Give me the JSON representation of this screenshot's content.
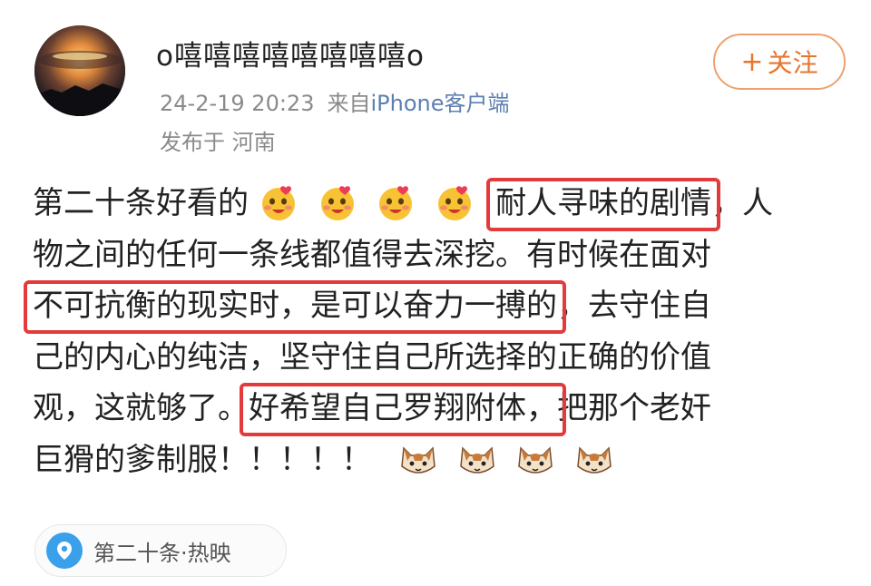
{
  "post": {
    "username": "o嘻嘻嘻嘻嘻嘻嘻嘻o",
    "timestamp": "24-2-19 20:23",
    "source_prefix": "来自",
    "source_device": "iPhone客户端",
    "location": "发布于 河南",
    "follow_label": "关注",
    "follow_plus": "+",
    "content": {
      "l1a": "第二十条好看的",
      "l1hl": "耐人寻味的剧情",
      "l1b": "，人",
      "l2": "物之间的任何一条线都值得去深挖。有时候在面对",
      "l3hl": "不可抗衡的现实时，是可以奋力一搏的",
      "l3b": "，去守住自",
      "l4": "己的内心的纯洁，坚守住自己所选择的正确的价值",
      "l5a": "观，这就够了。",
      "l5hl": "好希望自己罗翔附体，",
      "l5b": "把那个老奸",
      "l6": "巨猾的爹制服！！！！！"
    },
    "topic": "第二十条·热映"
  },
  "icons": {
    "avatar": "avatar-sunset-image",
    "emoji_a": "blushing-emoji-icon",
    "emoji_b": "cat-emoji-icon",
    "topic": "location-topic-icon"
  },
  "colors": {
    "highlight_box": "#e33b3b",
    "follow_accent": "#e6762c",
    "meta_gray": "#8a8a8a",
    "link_blue": "#5d7fb0",
    "topic_blue": "#3aa0ea"
  }
}
